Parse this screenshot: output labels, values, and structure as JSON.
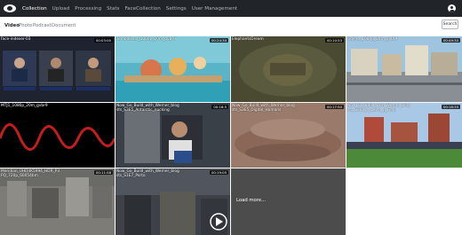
{
  "navbar": {
    "items": [
      {
        "label": "Collection",
        "active": true
      },
      {
        "label": "Upload",
        "active": false
      },
      {
        "label": "Processing",
        "active": false
      },
      {
        "label": "Stats",
        "active": false
      },
      {
        "label": "FaceCollection",
        "active": false
      },
      {
        "label": "Settings",
        "active": false
      },
      {
        "label": "User Management",
        "active": false
      }
    ],
    "brand_icon": "eye-logo-icon",
    "user_icon": "user-circle-icon"
  },
  "tabs": [
    {
      "label": "Video",
      "active": true
    },
    {
      "label": "Photo",
      "active": false
    },
    {
      "label": "Podcast",
      "active": false
    },
    {
      "label": "Document",
      "active": false
    }
  ],
  "search": {
    "label": "Search"
  },
  "tiles": [
    {
      "title": "face-indexer-03",
      "duration": "00:03:00"
    },
    {
      "title": "TumbleLeaf_1080p_20m_gvbr9",
      "duration": "00:24:30"
    },
    {
      "title": "ElephantsDream",
      "duration": "00:10:53"
    },
    {
      "title": "Goleta_1080p_20m_gvbr9",
      "duration": "00:49:30"
    },
    {
      "title": "MTJ1_1080p_20m_gvbr9",
      "duration": ""
    },
    {
      "title": "Now_Go_Build_with_Werner_blog\nsts_S3E5_Antarctic_nucking",
      "duration": "00:16:5"
    },
    {
      "title": "Now_Go_Build_with_Werner_blog\nsts_S3E5_Digital_Humans",
      "duration": "00:17:50"
    },
    {
      "title": "Now_Go_Build_with_Werner_blog\nsts_S3E6_A_Level_p_Field",
      "duration": "00:18:35"
    },
    {
      "title": "Meridian_UHD4K5994_HDR_P3\nPQ_720p_60054bm",
      "duration": "00:11:58"
    },
    {
      "title": "Now_Go_Build_with_Werner_blog\nsts_S1E7_Porto",
      "duration": "00:19:05"
    }
  ],
  "load_more": {
    "label": "Load more..."
  },
  "colors": {
    "navbar_bg": "#212529",
    "nav_inactive": "#adb5bd",
    "nav_active": "#ffffff",
    "load_more_bg": "#4c4c4c"
  }
}
